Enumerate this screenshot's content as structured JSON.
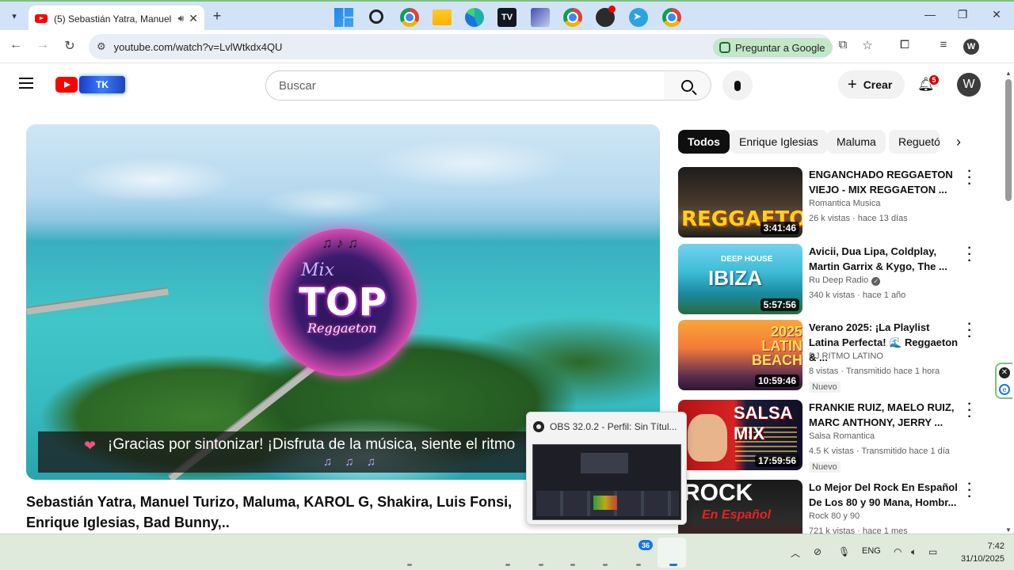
{
  "browser": {
    "tab_title": "(5) Sebastián Yatra, Manuel",
    "url": "youtube.com/watch?v=LvlWtkdx4QU",
    "ask_google_label": "Preguntar a Google",
    "profile_initial": "W",
    "icons": [
      "tab-search-icon",
      "youtube-favicon",
      "speaker-icon",
      "close-tab-icon",
      "new-tab-icon",
      "minimize-icon",
      "restore-icon",
      "close-window-icon",
      "back-icon",
      "forward-icon",
      "reload-icon",
      "site-info-icon",
      "install-app-icon",
      "bookmark-star-icon",
      "extensions-icon",
      "media-controls-icon"
    ]
  },
  "youtube": {
    "logo_badge": "TK",
    "search_placeholder": "Buscar",
    "create_label": "Crear",
    "notification_count": "5",
    "avatar_initial": "W"
  },
  "player": {
    "emblem_mix": "Mix",
    "emblem_top": "TOP",
    "emblem_sub": "Reggaeton",
    "emblem_notes": "♫ ♪ ♫",
    "ticker_heart": "❤",
    "ticker_text": "¡Gracias por sintonizar! ¡Disfruta de la música, siente el ritmo",
    "ticker_notes": "♫ ♫ ♫"
  },
  "video": {
    "title": "Sebastián Yatra, Manuel Turizo, Maluma, KAROL G, Shakira, Luis Fonsi, Enrique Iglesias, Bad Bunny,.."
  },
  "chips": [
    "Todos",
    "Enrique Iglesias",
    "Maluma",
    "Reguetón"
  ],
  "recommendations": [
    {
      "title": "ENGANCHADO REGGAETON VIEJO - MIX REGGAETON ...",
      "channel": "Romantica Musica",
      "meta": "26 k vistas · hace 13 días",
      "duration": "3:41:46",
      "thumb_text": "REGGAETON",
      "badge": ""
    },
    {
      "title": "Avicii, Dua Lipa, Coldplay, Martin Garrix & Kygo, The ...",
      "channel": "Ru Deep Radio",
      "verified": true,
      "meta": "340 k vistas · hace 1 año",
      "duration": "5:57:56",
      "thumb_text": "IBIZA",
      "thumb_sub": "DEEP HOUSE",
      "badge": ""
    },
    {
      "title": "Verano 2025: ¡La Playlist Latina Perfecta! 🌊 Reggaeton & ...",
      "channel": "DJ RITMO LATINO",
      "meta": "8 vistas · Transmitido hace 1 hora",
      "duration": "10:59:46",
      "thumb_text": "2025 LATIN BEACH",
      "badge": "Nuevo"
    },
    {
      "title": "FRANKIE RUIZ, MAELO RUIZ, MARC ANTHONY, JERRY ...",
      "channel": "Salsa Romantica",
      "meta": "4.5 K vistas · Transmitido hace 1 día",
      "duration": "17:59:56",
      "thumb_text": "SALSA MIX",
      "badge": "Nuevo"
    },
    {
      "title": "Lo Mejor Del Rock En Español De Los 80 y 90   Mana, Hombr...",
      "channel": "Rock 80 y 90",
      "meta": "721 k vistas · hace 1 mes",
      "duration": "",
      "thumb_text": "ROCK",
      "thumb_sub": "En Español",
      "badge": ""
    }
  ],
  "obs_preview": {
    "title": "OBS 32.0.2 - Perfil: Sin Títul..."
  },
  "taskbar": {
    "apps": [
      "windows-start-icon",
      "search-icon",
      "chrome-icon",
      "file-explorer-icon",
      "edge-icon",
      "tradingview-icon",
      "docs-app-icon",
      "chrome-profile-icon",
      "obs-icon",
      "telegram-icon",
      "chrome-active-icon"
    ],
    "telegram_badge": "36",
    "language": "ENG",
    "time": "7:42",
    "date": "31/10/2025"
  },
  "colors": {
    "youtube_red": "#ff0000",
    "chip_active": "#0f0f0f",
    "tab_strip": "#d3e3f7",
    "ask_google_bg": "#c3e7c9",
    "taskbar": "#dfe9dc"
  }
}
